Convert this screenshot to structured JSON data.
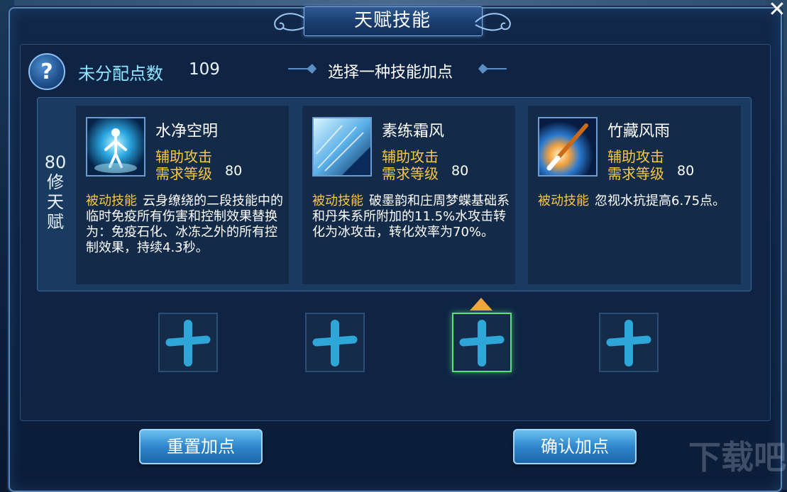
{
  "dialog": {
    "title": "天赋技能",
    "close_symbol": "✕"
  },
  "header": {
    "help_symbol": "?",
    "unassigned_label": "未分配点数",
    "unassigned_value": "109",
    "choose_prompt": "选择一种技能加点"
  },
  "tier": {
    "label": "80修天赋"
  },
  "skills": [
    {
      "name": "水净空明",
      "type": "辅助攻击",
      "req_label": "需求等级",
      "req_value": "80",
      "tag": "被动技能",
      "desc": "云身缭绕的二段技能中的临时免疫所有伤害和控制效果替换为：免疫石化、冰冻之外的所有控制效果，持续4.3秒。",
      "icon": "meditating-figure-icon"
    },
    {
      "name": "素练霜风",
      "type": "辅助攻击",
      "req_label": "需求等级",
      "req_value": "80",
      "tag": "被动技能",
      "desc": "破墨韵和庄周梦蝶基础系和丹朱系所附加的11.5%水攻击转化为冰攻击，转化效率为70%。",
      "icon": "ice-crystal-icon"
    },
    {
      "name": "竹藏风雨",
      "type": "辅助攻击",
      "req_label": "需求等级",
      "req_value": "80",
      "tag": "被动技能",
      "desc": "忽视水抗提高6.75点。",
      "icon": "brush-strike-icon"
    }
  ],
  "slots": [
    {
      "icon": "plus-icon",
      "selected": false
    },
    {
      "icon": "plus-icon",
      "selected": false
    },
    {
      "icon": "plus-icon",
      "selected": true
    },
    {
      "icon": "plus-icon",
      "selected": false
    }
  ],
  "buttons": {
    "reset": "重置加点",
    "confirm": "确认加点"
  },
  "watermark": "下载吧",
  "colors": {
    "accent_text": "#8fe4ff",
    "gold_text": "#f7c840",
    "selected_slot": "#5ae07a",
    "button_blue": "#2f86cc"
  }
}
